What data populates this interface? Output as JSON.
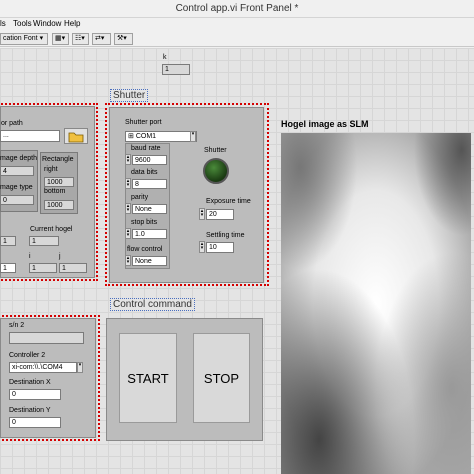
{
  "window": {
    "title": "Control app.vi Front Panel *"
  },
  "menu": [
    "ls",
    "Tools",
    "Window",
    "Help"
  ],
  "toolbar": {
    "font": "cation Font",
    "btn2": "▦▾",
    "btn3": "☷▾",
    "btn4": "⇄▾",
    "btn5": "⚒▾"
  },
  "k": {
    "label": "k",
    "value": "1"
  },
  "left_group": {
    "path_label": "or path",
    "path_value": "...",
    "image_depth_label": "mage depth",
    "image_depth_value": "4",
    "image_type_label": "mage type",
    "image_type_value": "0",
    "rectangle_label": "Rectangle",
    "right_label": "right",
    "right_value": "1000",
    "bottom_label": "bottom",
    "bottom_value": "1000",
    "current_hogel_label": "Current hogel",
    "current_hogel_value": "1",
    "i_label": "i",
    "j_label": "j",
    "i_value": "1",
    "j_value": "1",
    "left_value1": "1",
    "left_value2": "1"
  },
  "shutter": {
    "title": "Shutter",
    "port_label": "Shutter port",
    "port_value": "COM1",
    "baud_label": "baud rate",
    "baud_value": "9600",
    "databits_label": "data bits",
    "databits_value": "8",
    "parity_label": "parity",
    "parity_value": "None",
    "stopbits_label": "stop bits",
    "stopbits_value": "1.0",
    "flow_label": "flow control",
    "flow_value": "None",
    "indicator_label": "Shutter",
    "exposure_label": "Exposure time",
    "exposure_value": "20",
    "settling_label": "Settling time",
    "settling_value": "10"
  },
  "hogel": {
    "title": "Hogel image as SLM"
  },
  "control": {
    "title": "Control command",
    "start_label": "START",
    "stop_label": "STOP"
  },
  "controller": {
    "sn_label": "s/n 2",
    "controller_label": "Controller 2",
    "controller_value": "xi-com:\\\\.\\COM4",
    "destx_label": "Destination X",
    "destx_value": "0",
    "desty_label": "Destination Y",
    "desty_value": "0"
  }
}
